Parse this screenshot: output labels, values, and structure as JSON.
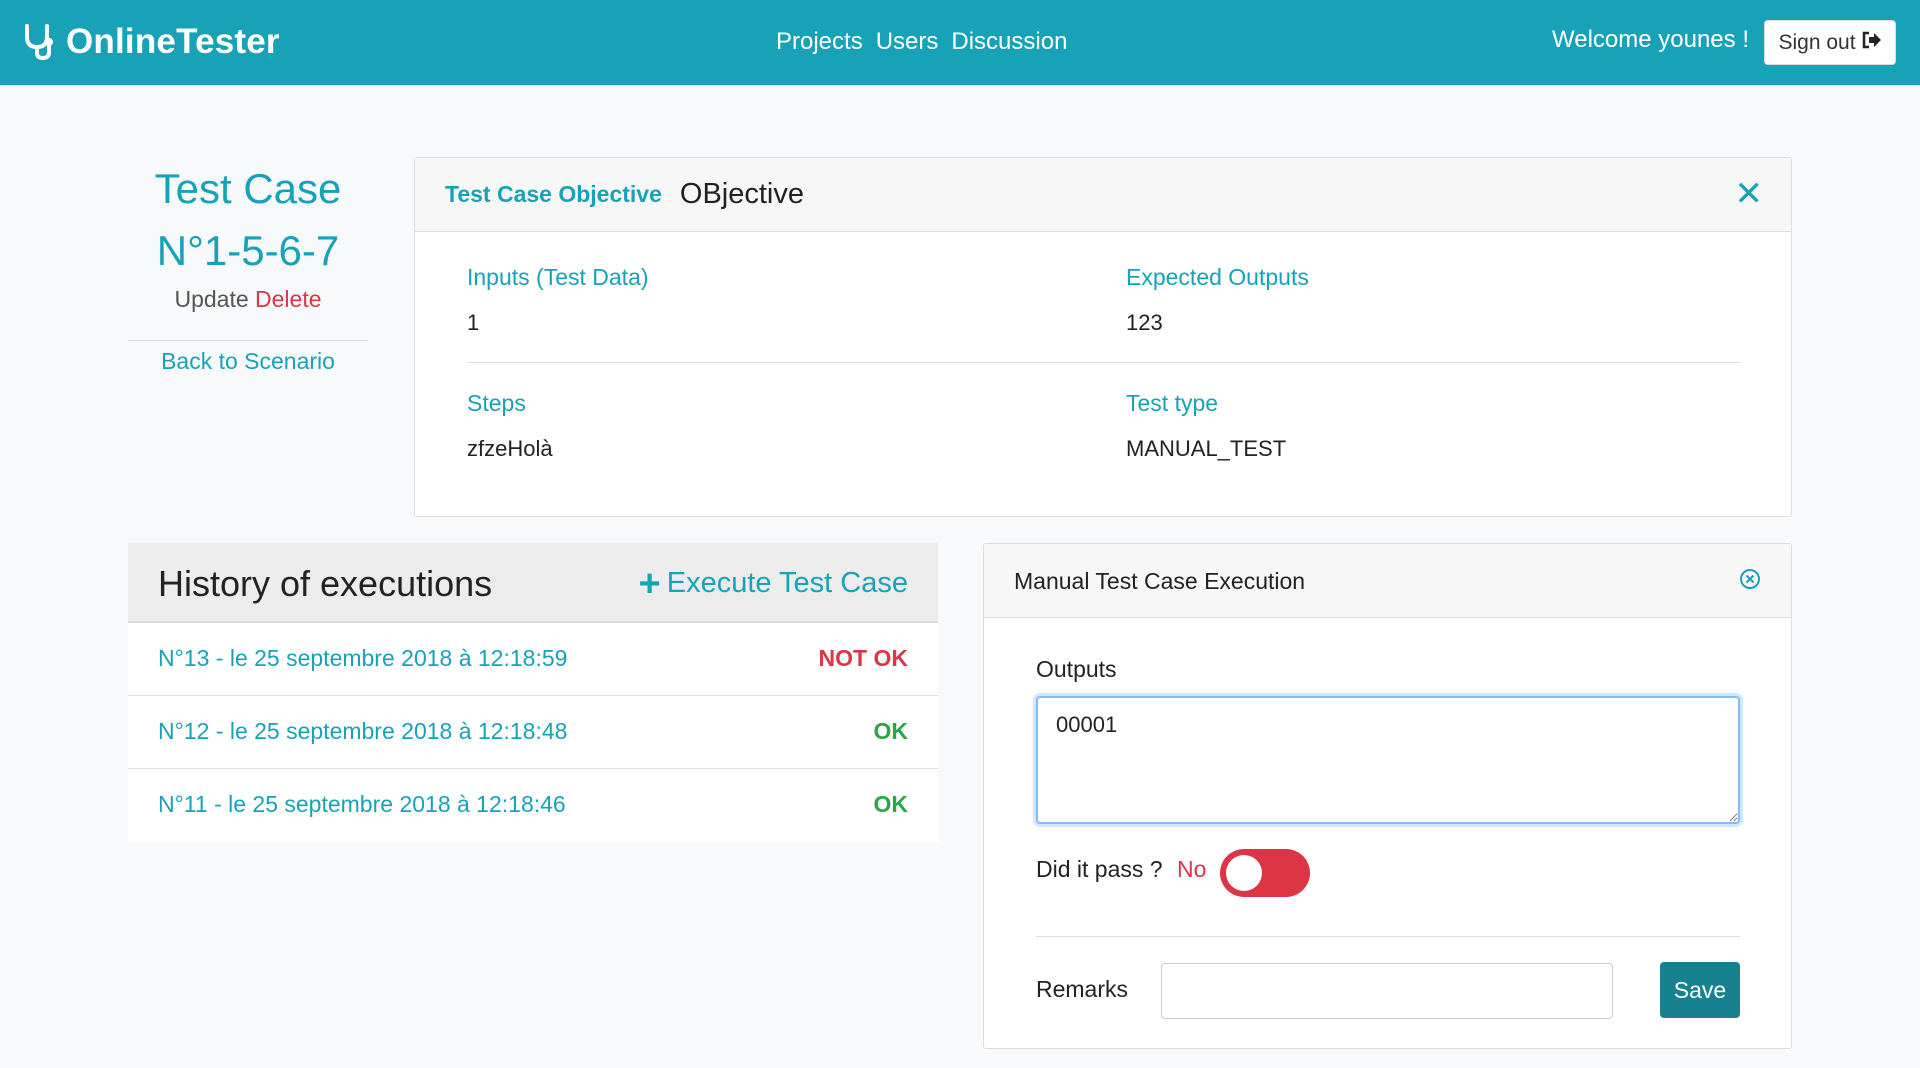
{
  "navbar": {
    "brand": "OnlineTester",
    "links": [
      "Projects",
      "Users",
      "Discussion"
    ],
    "welcome": "Welcome younes !",
    "signout": "Sign out",
    "color": "#17a2b8"
  },
  "test_case": {
    "title_line1": "Test Case",
    "title_line2": "N°1-5-6-7",
    "update": "Update",
    "delete": "Delete",
    "back": "Back to Scenario"
  },
  "objective": {
    "label": "Test Case Objective",
    "value": "OBjective",
    "inputs_label": "Inputs (Test Data)",
    "inputs_value": "1",
    "expected_label": "Expected Outputs",
    "expected_value": "123",
    "steps_label": "Steps",
    "steps_value": "zfzeHolà",
    "type_label": "Test type",
    "type_value": "MANUAL_TEST"
  },
  "history": {
    "title": "History of executions",
    "execute_label": "Execute Test Case",
    "rows": [
      {
        "label": "N°13 - le 25 septembre 2018 à 12:18:59",
        "status": "NOT OK",
        "color": "#dc3545"
      },
      {
        "label": "N°12 - le 25 septembre 2018 à 12:18:48",
        "status": "OK",
        "color": "#28a745"
      },
      {
        "label": "N°11 - le 25 septembre 2018 à 12:18:46",
        "status": "OK",
        "color": "#28a745"
      }
    ]
  },
  "execution": {
    "title": "Manual Test Case Execution",
    "outputs_label": "Outputs",
    "outputs_value": "00001",
    "pass_label": "Did it pass ?",
    "pass_value": "No",
    "remarks_label": "Remarks",
    "remarks_value": "",
    "save_label": "Save"
  }
}
